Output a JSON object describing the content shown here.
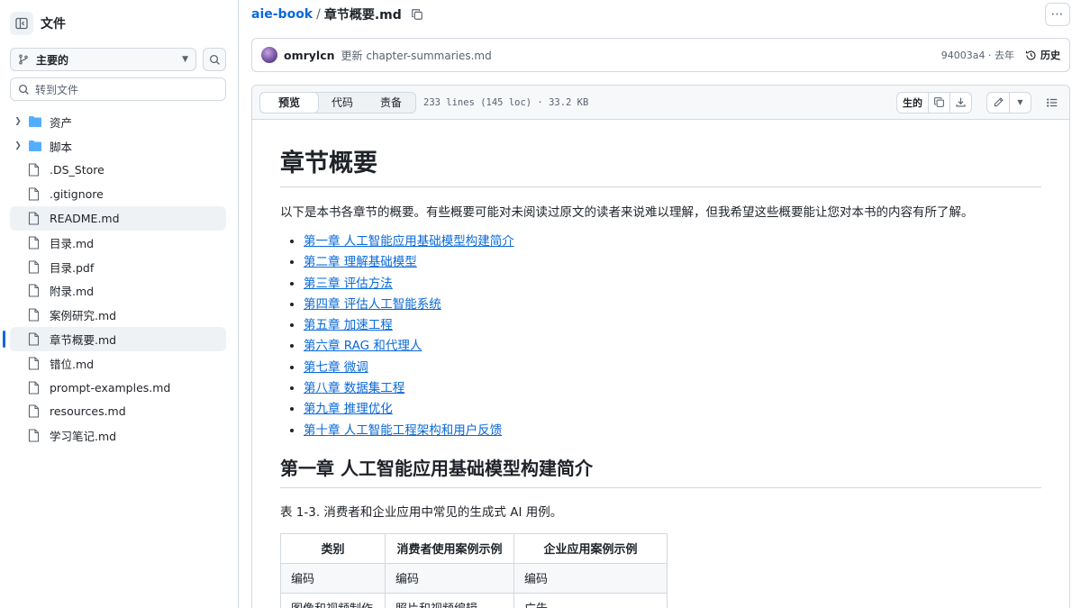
{
  "sidebar": {
    "title": "文件",
    "branch": "主要的",
    "goto_placeholder": "转到文件",
    "items": [
      {
        "label": "资产",
        "type": "folder"
      },
      {
        "label": "脚本",
        "type": "folder"
      },
      {
        "label": ".DS_Store",
        "type": "file"
      },
      {
        "label": ".gitignore",
        "type": "file"
      },
      {
        "label": "README.md",
        "type": "file"
      },
      {
        "label": "目录.md",
        "type": "file"
      },
      {
        "label": "目录.pdf",
        "type": "file"
      },
      {
        "label": "附录.md",
        "type": "file"
      },
      {
        "label": "案例研究.md",
        "type": "file"
      },
      {
        "label": "章节概要.md",
        "type": "file"
      },
      {
        "label": "错位.md",
        "type": "file"
      },
      {
        "label": "prompt-examples.md",
        "type": "file"
      },
      {
        "label": "resources.md",
        "type": "file"
      },
      {
        "label": "学习笔记.md",
        "type": "file"
      }
    ]
  },
  "breadcrumb": {
    "repo": "aie-book",
    "sep": "/",
    "file": "章节概要.md"
  },
  "commit": {
    "author": "omrylcn",
    "message": "更新 chapter-summaries.md",
    "hash_time": "94003a4 · 去年",
    "history_label": "历史"
  },
  "file_header": {
    "tabs": [
      "预览",
      "代码",
      "责备"
    ],
    "meta": "233 lines (145 loc) · 33.2 KB",
    "raw_label": "生的"
  },
  "content": {
    "h1": "章节概要",
    "intro": "以下是本书各章节的概要。有些概要可能对未阅读过原文的读者来说难以理解，但我希望这些概要能让您对本书的内容有所了解。",
    "toc": [
      "第一章 人工智能应用基础模型构建简介",
      "第二章 理解基础模型",
      "第三章 评估方法",
      "第四章 评估人工智能系统",
      "第五章 加速工程",
      "第六章 RAG 和代理人",
      "第七章 微调",
      "第八章 数据集工程",
      "第九章 推理优化",
      "第十章 人工智能工程架构和用户反馈"
    ],
    "h2": "第一章 人工智能应用基础模型构建简介",
    "caption": "表 1-3. 消费者和企业应用中常见的生成式 AI 用例。",
    "table": {
      "headers": [
        "类别",
        "消费者使用案例示例",
        "企业应用案例示例"
      ],
      "rows": [
        [
          "编码",
          "编码",
          "编码"
        ],
        [
          "图像和视频制作",
          "照片和视频编辑",
          "广告"
        ]
      ]
    }
  },
  "colors": {
    "link": "#0969da",
    "border": "#d1d9e0",
    "muted": "#59636e",
    "selection_bar": "#0969da"
  }
}
